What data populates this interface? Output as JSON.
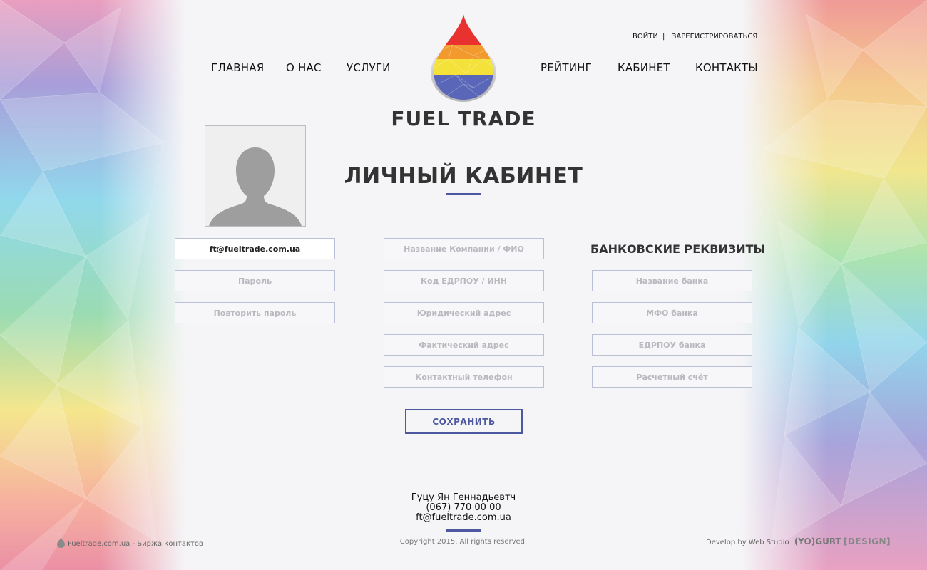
{
  "auth": {
    "login_label": "ВОЙТИ",
    "separator": "|",
    "register_label": "ЗАРЕГИСТРИРОВАТЬСЯ"
  },
  "nav": {
    "left": [
      "ГЛАВНАЯ",
      "О НАС",
      "УСЛУГИ"
    ],
    "right": [
      "РЕЙТИНГ",
      "КАБИНЕТ",
      "КОНТАКТЫ"
    ]
  },
  "logo": {
    "text": "FUEL TRADE",
    "colors": [
      "#e8322f",
      "#f29a2e",
      "#f4e23a",
      "#5a67b8"
    ]
  },
  "page": {
    "title": "ЛИЧНЫЙ КАБИНЕТ",
    "accent_color": "#4d58a0"
  },
  "account": {
    "email_value": "ft@fueltrade.com.ua",
    "password_placeholder": "Пароль",
    "repeat_password_placeholder": "Повторить пароль"
  },
  "company": {
    "name_placeholder": "Название Компании / ФИО",
    "edrpou_placeholder": "Код ЕДРПОУ / ИНН",
    "legal_address_placeholder": "Юридический адрес",
    "actual_address_placeholder": "Фактический адрес",
    "phone_placeholder": "Контактный телефон"
  },
  "bank": {
    "heading": "БАНКОВСКИЕ РЕКВИЗИТЫ",
    "bank_name_placeholder": "Название банка",
    "mfo_placeholder": "МФО банка",
    "edrpou_placeholder": "ЕДРПОУ банка",
    "account_placeholder": "Расчетный счёт"
  },
  "save_label": "СОХРАНИТЬ",
  "contact": {
    "name": "Гуцу Ян Геннадьевтч",
    "phone": "(067) 770 00 00",
    "email": "ft@fueltrade.com.ua"
  },
  "footer": {
    "left_text": "Fueltrade.com.ua - Биржа контактов",
    "copyright": "Copyright 2015. All rights reserved.",
    "develop_text": "Develop by Web Studio",
    "studio_name": "(YO)GURT",
    "studio_suffix": "[DESIGN]"
  }
}
